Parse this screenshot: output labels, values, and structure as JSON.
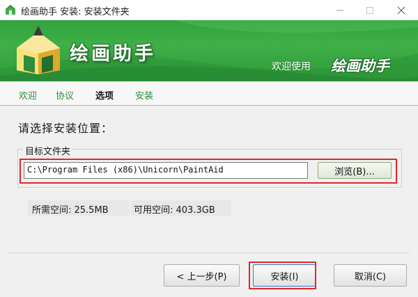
{
  "window": {
    "title": "绘画助手 安装: 安装文件夹",
    "minimize_icon": "minimize-icon",
    "maximize_icon": "maximize-icon",
    "close_icon": "close-icon"
  },
  "banner": {
    "app_name": "绘画助手",
    "welcome_prefix": "欢迎使用",
    "welcome_app": "绘画助手",
    "logo_icon": "pencil-house-logo",
    "colors": {
      "green": "#3faf47",
      "dark_green": "#1f6e27"
    }
  },
  "steps": [
    {
      "label": "欢迎",
      "active": false
    },
    {
      "label": "协议",
      "active": false
    },
    {
      "label": "选项",
      "active": true
    },
    {
      "label": "安装",
      "active": false
    }
  ],
  "content": {
    "heading": "请选择安装位置：",
    "group_label": "目标文件夹",
    "path_value": "C:\\Program Files (x86)\\Unicorn\\PaintAid",
    "browse_label": "浏览(B)...",
    "space_required": "所需空间: 25.5MB",
    "space_available": "可用空间: 403.3GB"
  },
  "buttons": {
    "back": "< 上一步(P)",
    "install": "安装(I)",
    "cancel": "取消(C)"
  },
  "highlight_color": "#e0272b"
}
